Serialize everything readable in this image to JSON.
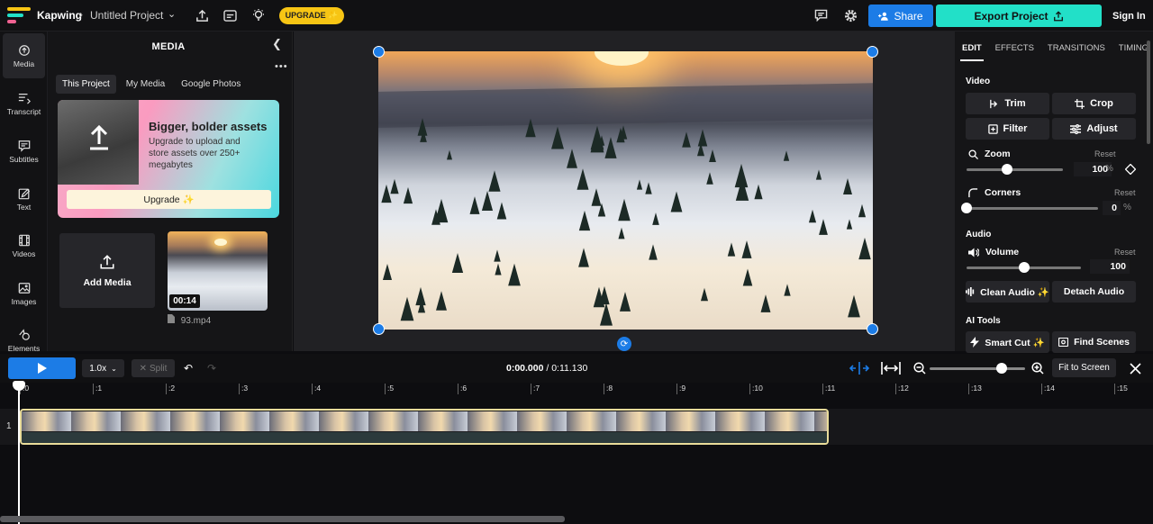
{
  "app": {
    "brand": "Kapwing",
    "project_name": "Untitled Project",
    "upgrade_pill": "UPGRADE ✨",
    "share": "Share",
    "export": "Export Project",
    "sign_in": "Sign In"
  },
  "rail": [
    {
      "label": "Media",
      "icon": "media-icon"
    },
    {
      "label": "Transcript",
      "icon": "transcript-icon"
    },
    {
      "label": "Subtitles",
      "icon": "subtitles-icon"
    },
    {
      "label": "Text",
      "icon": "text-icon"
    },
    {
      "label": "Videos",
      "icon": "videos-icon"
    },
    {
      "label": "Images",
      "icon": "images-icon"
    },
    {
      "label": "Elements",
      "icon": "elements-icon"
    }
  ],
  "media": {
    "title": "MEDIA",
    "tabs": [
      "This Project",
      "My Media",
      "Google Photos"
    ],
    "promo": {
      "title": "Bigger, bolder assets",
      "text": "Upgrade to upload and store assets over 250+ megabytes",
      "button": "Upgrade ✨"
    },
    "add_media": "Add Media",
    "file": {
      "duration": "00:14",
      "name": "93.mp4"
    }
  },
  "right": {
    "tabs": [
      "EDIT",
      "EFFECTS",
      "TRANSITIONS",
      "TIMING"
    ],
    "video_section": "Video",
    "buttons": [
      "Trim",
      "Crop",
      "Filter",
      "Adjust"
    ],
    "zoom": {
      "label": "Zoom",
      "reset": "Reset",
      "value": "100",
      "unit": "%",
      "level": 0.42
    },
    "corners": {
      "label": "Corners",
      "reset": "Reset",
      "value": "0",
      "unit": "%",
      "level": 0.0
    },
    "audio_section": "Audio",
    "volume": {
      "label": "Volume",
      "reset": "Reset",
      "value": "100",
      "level": 0.5
    },
    "clean_audio": "Clean Audio ✨",
    "detach_audio": "Detach Audio",
    "ai_section": "AI Tools",
    "smart_cut": "Smart Cut ✨",
    "find_scenes": "Find Scenes"
  },
  "timeline": {
    "speed": "1.0x",
    "split": "Split",
    "current_time": "0:00.000",
    "total_time": "0:11.130",
    "fit": "Fit to Screen",
    "track_number": "1",
    "ticks": [
      ":0",
      ":1",
      ":2",
      ":3",
      ":4",
      ":5",
      ":6",
      ":7",
      ":8",
      ":9",
      ":10",
      ":11",
      ":12",
      ":13",
      ":14",
      ":15"
    ]
  },
  "colors": {
    "accent_blue": "#1c7ce6",
    "export_teal": "#22e0c8",
    "upgrade_yellow": "#f7c514"
  }
}
